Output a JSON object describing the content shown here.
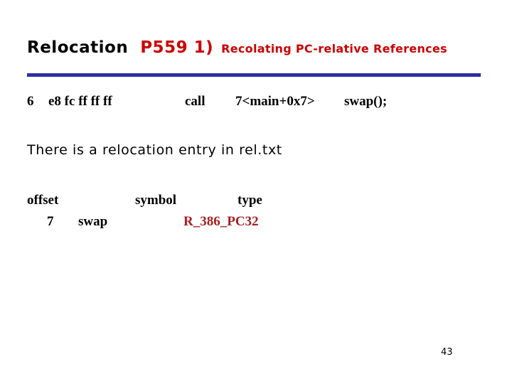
{
  "slide": {
    "title": {
      "main": "Relocation",
      "code": "P559 1)",
      "subtitle": "Recolating PC-relative References"
    },
    "rule_color": "#2e2fa0",
    "accent_red": "#cc0000",
    "type_red": "#a81f1f",
    "disassembly": {
      "address": "6",
      "bytes": "e8 fc ff ff ff",
      "mnemonic": "call",
      "target": "7<main+0x7>",
      "comment": "swap();"
    },
    "note": "There is a relocation entry in rel.txt",
    "relocation_table": {
      "headers": [
        "offset",
        "symbol",
        "type"
      ],
      "rows": [
        {
          "offset": "7",
          "symbol": "swap",
          "type": "R_386_PC32"
        }
      ]
    },
    "page_number": "43"
  }
}
